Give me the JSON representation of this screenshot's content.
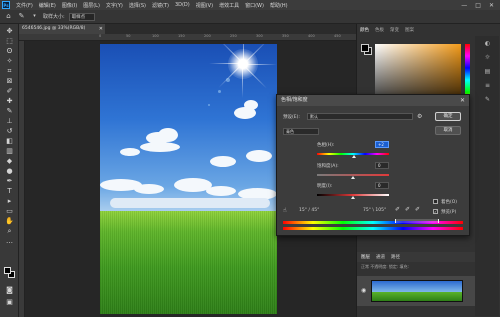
{
  "app": {
    "logo": "Ps",
    "menu": [
      "文件(F)",
      "编辑(E)",
      "图像(I)",
      "图层(L)",
      "文字(Y)",
      "选择(S)",
      "滤镜(T)",
      "3D(D)",
      "视图(V)",
      "增效工具",
      "窗口(W)",
      "帮助(H)"
    ],
    "window_controls": [
      "—",
      "□",
      "✕"
    ]
  },
  "options_bar": {
    "sample_size_label": "取样大小:",
    "sample_size_value": "取样点"
  },
  "document": {
    "tab_title": "6546546.jpg @ 33%(RGB/8)",
    "tab_close": "✕",
    "ruler_numbers": [
      "0",
      "50",
      "100",
      "150",
      "200",
      "250",
      "300",
      "350",
      "400",
      "450"
    ]
  },
  "right_panel": {
    "tabs": [
      "颜色",
      "色板",
      "渐变",
      "图案"
    ],
    "layers_tabs": [
      "图层",
      "通道",
      "路径"
    ],
    "layers_controls": "正常    不透明度:    锁定:    填充:"
  },
  "dialog": {
    "title": "色相/饱和度",
    "close": "✕",
    "preset_label": "预设(E):",
    "preset_value": "默认",
    "ok_label": "确定",
    "cancel_label": "取消",
    "channel_value": "青色",
    "hue_label": "色相(H):",
    "hue_value": "+2",
    "saturation_label": "饱和度(A):",
    "saturation_value": "0",
    "lightness_label": "明度(I):",
    "lightness_value": "0",
    "range_left": "15° / 45°",
    "range_right": "75° \\ 105°",
    "colorize_label": "着色(O)",
    "preview_label": "预览(P)",
    "preview_checked": "✓"
  },
  "colors": {
    "accent": "#1b5fd1",
    "picker_color": "#f39b1a",
    "dialog_bg": "#3c3c3c"
  }
}
